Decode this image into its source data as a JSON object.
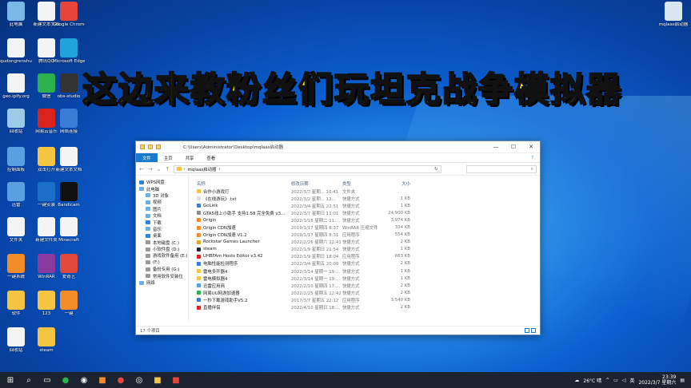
{
  "banner": {
    "text": "这边来教粉丝们玩坦克战争模拟器"
  },
  "desktop": {
    "icons": [
      {
        "label": "此电脑",
        "icon": "computer-icon",
        "color": "#7ab8e8"
      },
      {
        "label": "新建文本文档",
        "icon": "document-icon",
        "color": "#f4f4f4"
      },
      {
        "label": "Google Chrome",
        "icon": "chrome-icon",
        "color": "#e7443a"
      },
      {
        "label": "qudongrenshu",
        "icon": "document-icon",
        "color": "#f4f4f4"
      },
      {
        "label": "腾讯QQ",
        "icon": "document-icon",
        "color": "#f4f4f4"
      },
      {
        "label": "Microsoft Edge",
        "icon": "edge-icon",
        "color": "#1fa3d8"
      },
      {
        "label": "geo.ipify.org",
        "icon": "document-icon",
        "color": "#f4f4f4"
      },
      {
        "label": "微信",
        "icon": "wechat-icon",
        "color": "#2bb24c"
      },
      {
        "label": "obs-studio",
        "icon": "obs-icon",
        "color": "#333333"
      },
      {
        "label": "回收站",
        "icon": "recycle-bin-icon",
        "color": "#9ccbe8"
      },
      {
        "label": "网易云音乐",
        "icon": "music-icon",
        "color": "#d8231e"
      },
      {
        "label": "网络连接",
        "icon": "network-icon",
        "color": "#3a7bd5"
      },
      {
        "label": "控制面板",
        "icon": "control-panel-icon",
        "color": "#5aa0e0"
      },
      {
        "label": "双击打开",
        "icon": "folder-icon",
        "color": "#f5c542"
      },
      {
        "label": "新建文本文档",
        "icon": "document-icon",
        "color": "#f4f4f4"
      },
      {
        "label": "迅雷",
        "icon": "thunder-icon",
        "color": "#5aa0e0"
      },
      {
        "label": "一键安装",
        "icon": "app-icon",
        "color": "#1a6fc9"
      },
      {
        "label": "Bandicam",
        "icon": "app-icon",
        "color": "#111111"
      },
      {
        "label": "文件夹",
        "icon": "folder-icon",
        "color": "#f4f4f4"
      },
      {
        "label": "新建文件夹",
        "icon": "folder-icon",
        "color": "#f4f4f4"
      },
      {
        "label": "Minecraft",
        "icon": "document-icon",
        "color": "#f4f4f4"
      },
      {
        "label": "一键系统",
        "icon": "app-icon",
        "color": "#f28c28"
      },
      {
        "label": "WinRAR",
        "icon": "winrar-icon",
        "color": "#8a3a9e"
      },
      {
        "label": "爱奇艺",
        "icon": "iqiyi-icon",
        "color": "#e2483c"
      },
      {
        "label": "软件",
        "icon": "folder-icon",
        "color": "#f5c542"
      },
      {
        "label": "123",
        "icon": "folder-icon",
        "color": "#f5c542"
      },
      {
        "label": "一键",
        "icon": "app-icon",
        "color": "#f28c28"
      },
      {
        "label": "回收站",
        "icon": "recycle-icon",
        "color": "#f4f4f4"
      },
      {
        "label": "steam",
        "icon": "folder-icon",
        "color": "#f5c542"
      },
      {
        "label": "mqlaas启动器",
        "icon": "launcher-icon",
        "color": "#d8e6f4"
      }
    ]
  },
  "explorer": {
    "title_path": "C:\\Users\\Administrator\\Desktop\\mqlaas启动器",
    "window_buttons": [
      "—",
      "☐",
      "✕"
    ],
    "ribbon_tabs": [
      "文件",
      "主页",
      "共享",
      "查看"
    ],
    "address_crumb": "mqlaas启动器",
    "nav_items": [
      {
        "label": "WPS网盘",
        "indent": false,
        "color": "#2b82e8"
      },
      {
        "label": "此电脑",
        "indent": false,
        "color": "#6ab0e6"
      },
      {
        "label": "3D 对象",
        "indent": true,
        "color": "#6ab0e6"
      },
      {
        "label": "视频",
        "indent": true,
        "color": "#6ab0e6"
      },
      {
        "label": "图片",
        "indent": true,
        "color": "#6ab0e6"
      },
      {
        "label": "文档",
        "indent": true,
        "color": "#6ab0e6"
      },
      {
        "label": "下载",
        "indent": true,
        "color": "#2b82e8"
      },
      {
        "label": "音乐",
        "indent": true,
        "color": "#6ab0e6"
      },
      {
        "label": "桌面",
        "indent": true,
        "color": "#2b82e8"
      },
      {
        "label": "本地磁盘 (C:)",
        "indent": true,
        "color": "#999999"
      },
      {
        "label": "小软件盘 (D:)",
        "indent": true,
        "color": "#999999"
      },
      {
        "label": "游戏软件备用 (E:)",
        "indent": true,
        "color": "#999999"
      },
      {
        "label": "(F:)",
        "indent": true,
        "color": "#999999"
      },
      {
        "label": "备份专用 (G:)",
        "indent": true,
        "color": "#999999"
      },
      {
        "label": "常用软件安装位",
        "indent": true,
        "color": "#999999"
      },
      {
        "label": "网络",
        "indent": false,
        "color": "#6ab0e6"
      }
    ],
    "columns": {
      "name": "名称",
      "date": "修改日期",
      "type": "类型",
      "size": "大小"
    },
    "files": [
      {
        "name": "合作小游戏打",
        "date": "2022/3/7 星期... 10:41",
        "type": "文件夹",
        "size": "",
        "color": "#f5c542"
      },
      {
        "name": "《在线游玩》.txt",
        "date": "2022/3/2 星期... 12...",
        "type": "快捷方式",
        "size": "1 KB",
        "color": "#dddddd"
      },
      {
        "name": "GoLink",
        "date": "2022/3/4 星期五 22:51",
        "type": "快捷方式",
        "size": "1 KB",
        "color": "#3a7bd5"
      },
      {
        "name": "GTA5线上小助手 支持1.58 完全免费 v3...",
        "date": "2022/3/7 星期日 11:01",
        "type": "快捷方式",
        "size": "24,900 KB",
        "color": "#8a8a8a"
      },
      {
        "name": "Origin",
        "date": "2022/1/18 星期二 11:...",
        "type": "快捷方式",
        "size": "3,974 KB",
        "color": "#f28c28"
      },
      {
        "name": "Origin CDN加速",
        "date": "2019/1/17 星期四 8:37",
        "type": "WinRAR 压缩文件",
        "size": "334 KB",
        "color": "#f28c28"
      },
      {
        "name": "Origin CDN加速 V1.2",
        "date": "2019/1/17 星期四 8:31",
        "type": "应用程序",
        "size": "554 KB",
        "color": "#f28c28"
      },
      {
        "name": "Rockstar Games Launcher",
        "date": "2022/2/26 星期六 22:41",
        "type": "快捷方式",
        "size": "2 KB",
        "color": "#e6a520"
      },
      {
        "name": "steam",
        "date": "2022/1/9 星期日 21:54",
        "type": "快捷方式",
        "size": "1 KB",
        "color": "#1b2838"
      },
      {
        "name": "UHBFAm Hosts Editor v3.42",
        "date": "2022/1/9 星期日 18:04",
        "type": "应用程序",
        "size": "663 KB",
        "color": "#d8231e"
      },
      {
        "name": "电脑性能检测程序",
        "date": "2022/3/4 星期五 20:09",
        "type": "快捷方式",
        "size": "2 KB",
        "color": "#3a7bd5"
      },
      {
        "name": "雷电多开器4",
        "date": "2022/3/14 星期一 19:...",
        "type": "快捷方式",
        "size": "1 KB",
        "color": "#f5c542"
      },
      {
        "name": "雷电模拟器4",
        "date": "2022/3/14 星期一 19:...",
        "type": "快捷方式",
        "size": "1 KB",
        "color": "#f5c542"
      },
      {
        "name": "迅雷应用商",
        "date": "2022/2/10 星期四 17:...",
        "type": "快捷方式",
        "size": "2 KB",
        "color": "#5aa0e0"
      },
      {
        "name": "网易UU网游加速器",
        "date": "2022/2/25 星期五 22:42",
        "type": "快捷方式",
        "size": "2 KB",
        "color": "#2bb24c"
      },
      {
        "name": "一秒下载游戏助手V5.2",
        "date": "2017/3/7 星期五 22:12",
        "type": "应用程序",
        "size": "3,540 KB",
        "color": "#3a7bd5"
      },
      {
        "name": "直播伴侣",
        "date": "2022/4/10 星期日 18:...",
        "type": "快捷方式",
        "size": "2 KB",
        "color": "#d8231e"
      }
    ],
    "status": "17 个项目"
  },
  "taskbar": {
    "weather": "26°C 晴",
    "time": "23:39",
    "date": "2022/3/7 星期六"
  }
}
